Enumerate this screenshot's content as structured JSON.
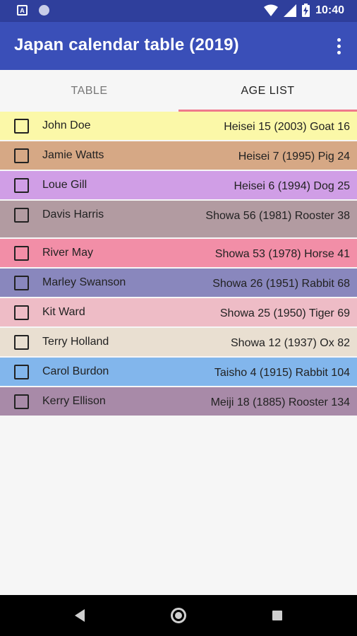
{
  "status_bar": {
    "time": "10:40",
    "icons": [
      "app-notification-icon",
      "circle-notification-icon",
      "wifi-icon",
      "signal-icon",
      "battery-charging-icon"
    ]
  },
  "app_bar": {
    "title": "Japan calendar table (2019)",
    "menu_icon": "more-vert-icon",
    "color": "#3a4fb8"
  },
  "tabs": [
    {
      "label": "TABLE",
      "active": false
    },
    {
      "label": "AGE LIST",
      "active": true
    }
  ],
  "tab_indicator_color": "#ef7a8c",
  "rows": [
    {
      "name": "John Doe",
      "info": "Heisei 15  (2003) Goat  16",
      "color": "#fbf8a8"
    },
    {
      "name": "Jamie Watts",
      "info": "Heisei 7  (1995) Pig  24",
      "color": "#d6a885"
    },
    {
      "name": "Loue Gill",
      "info": "Heisei 6  (1994) Dog  25",
      "color": "#d09ee6"
    },
    {
      "name": "Davis Harris",
      "info": "Showa 56  (1981) Rooster  38",
      "color": "#b29ba1"
    },
    {
      "name": "River May",
      "info": "Showa 53  (1978) Horse  41",
      "color": "#f28ea7"
    },
    {
      "name": "Marley Swanson",
      "info": "Showa 26  (1951) Rabbit  68",
      "color": "#8987bd"
    },
    {
      "name": "Kit Ward",
      "info": "Showa 25  (1950) Tiger  69",
      "color": "#eebcc6"
    },
    {
      "name": "Terry Holland",
      "info": "Showa 12  (1937) Ox  82",
      "color": "#e9dfd1"
    },
    {
      "name": "Carol Burdon",
      "info": "Taisho 4  (1915) Rabbit  104",
      "color": "#82b6ec"
    },
    {
      "name": "Kerry Ellison",
      "info": "Meiji 18  (1885) Rooster  134",
      "color": "#a88aa8"
    }
  ],
  "nav_bar": {
    "icons": [
      "back-icon",
      "home-icon",
      "recents-icon"
    ]
  }
}
